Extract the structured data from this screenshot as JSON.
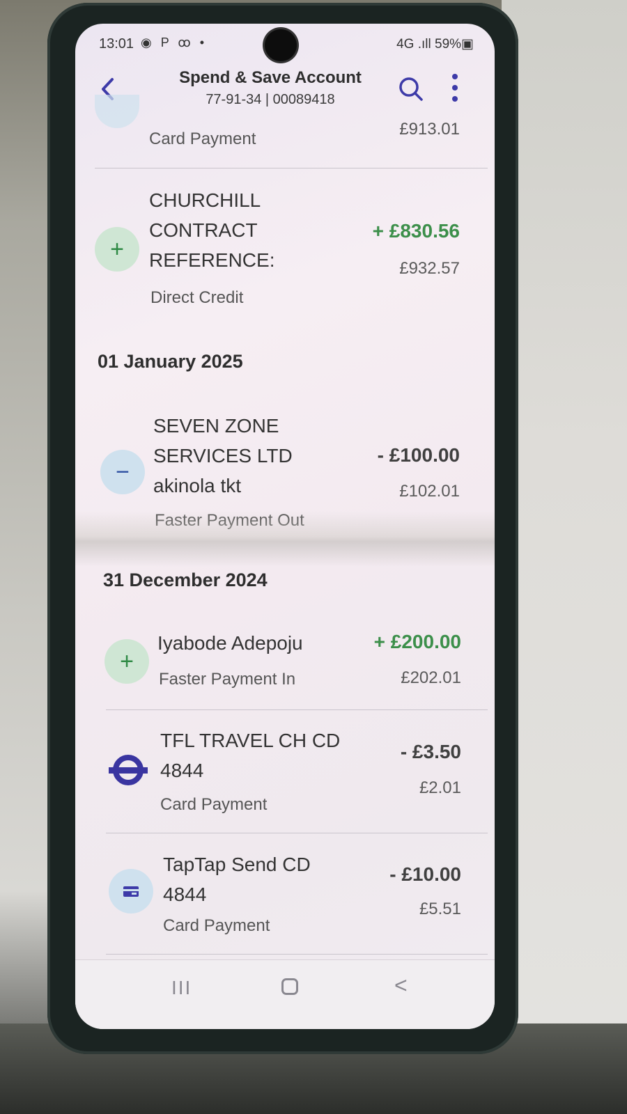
{
  "status_bar": {
    "time": "13:01",
    "left_icons": "◉ P ꝏ •",
    "right": "4G .ıll 59%▣"
  },
  "header": {
    "title": "Spend & Save Account",
    "subtitle": "77-91-34 | 00089418"
  },
  "transactions": [
    {
      "name": "",
      "type": "Card Payment",
      "amount": "",
      "balance": "£913.01",
      "kind": "partial"
    },
    {
      "name": "CHURCHILL CONTRACT REFERENCE:",
      "type": "Direct Credit",
      "amount": "+ £830.56",
      "balance": "£932.57",
      "kind": "credit",
      "icon": "plus-icon"
    },
    {
      "date": "01 January 2025"
    },
    {
      "name": "SEVEN ZONE SERVICES LTD akinola tkt",
      "type": "Faster Payment Out",
      "amount": "- £100.00",
      "balance": "£102.01",
      "kind": "debit",
      "icon": "minus-icon"
    },
    {
      "date": "31 December 2024"
    },
    {
      "name": "Iyabode Adepoju",
      "type": "Faster Payment In",
      "amount": "+ £200.00",
      "balance": "£202.01",
      "kind": "credit",
      "icon": "plus-icon"
    },
    {
      "name": "TFL TRAVEL CH CD 4844",
      "type": "Card Payment",
      "amount": "- £3.50",
      "balance": "£2.01",
      "kind": "debit",
      "icon": "tfl-roundel-icon"
    },
    {
      "name": "TapTap Send CD 4844",
      "type": "Card Payment",
      "amount": "- £10.00",
      "balance": "£5.51",
      "kind": "debit",
      "icon": "card-icon"
    }
  ],
  "colors": {
    "accent": "#3d3aa8",
    "credit": "#3c8f4a",
    "debit": "#404040"
  },
  "nav": {
    "recent": "III",
    "back": "<"
  }
}
